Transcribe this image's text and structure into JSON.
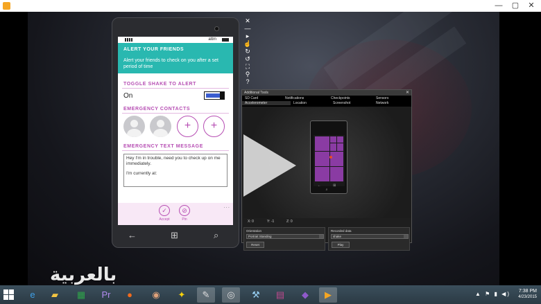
{
  "window": {
    "controls": {
      "minimize": "—",
      "maximize": "▢",
      "close": "✕"
    }
  },
  "phone": {
    "carrier": "attm",
    "header_title": "ALERT YOUR FRIENDS",
    "header_desc": "Alert your friends to check on you after a set period of time",
    "toggle_section": "TOGGLE SHAKE TO ALERT",
    "toggle_state": "On",
    "toggle_on": true,
    "contacts_section": "EMERGENCY CONTACTS",
    "contacts": [
      "contact",
      "contact"
    ],
    "add_contact": [
      "+",
      "+"
    ],
    "message_section": "EMERGENCY TEXT MESSAGE",
    "message_line1": "Hey I'm in trouble, need you to check up on me immediately.",
    "message_line2": "I'm currently at:",
    "appbar": [
      {
        "label": "Accept",
        "glyph": "✓"
      },
      {
        "label": "Pin",
        "glyph": "⊘"
      }
    ],
    "appbar_more": "...",
    "nav": {
      "back": "←",
      "home": "⊞",
      "search": "⌕"
    }
  },
  "emulator_toolbar": [
    "✕",
    "—",
    "▸",
    "☝",
    "↻",
    "↺",
    "⛶",
    "⚲",
    "?"
  ],
  "additional_tools": {
    "title": "Additional Tools",
    "close": "✕",
    "tabs_row1": [
      "SD Card",
      "Notifications",
      "Checkpoints",
      "Sensors"
    ],
    "tabs_row2": [
      "Accelerometer",
      "Location",
      "Screenshot",
      "Network"
    ],
    "active_tab": "Accelerometer",
    "mini_nav": "← ⊞ ⌕",
    "x_label": "X: 0",
    "y_label": "Y: -1",
    "z_label": "Z: 0",
    "orientation_label": "Orientation",
    "orientation_value": "Portrait Standing",
    "reset_label": "Reset",
    "recorded_label": "Recorded data",
    "recorded_value": "shake",
    "play_label": "Play"
  },
  "logo_text": "بالعربية",
  "taskbar": {
    "apps": [
      "ie",
      "explorer",
      "excel",
      "premiere",
      "firefox",
      "app",
      "aim",
      "paint",
      "chrome",
      "tools",
      "winrar",
      "visualstudio",
      "player"
    ],
    "tray": "▲ ⚑ ▮ ◀)",
    "time": "7:38 PM",
    "date": "4/23/2015"
  },
  "colors": {
    "accent": "#29b8b0",
    "purple": "#b64db3",
    "taskbar": "#34464f"
  }
}
